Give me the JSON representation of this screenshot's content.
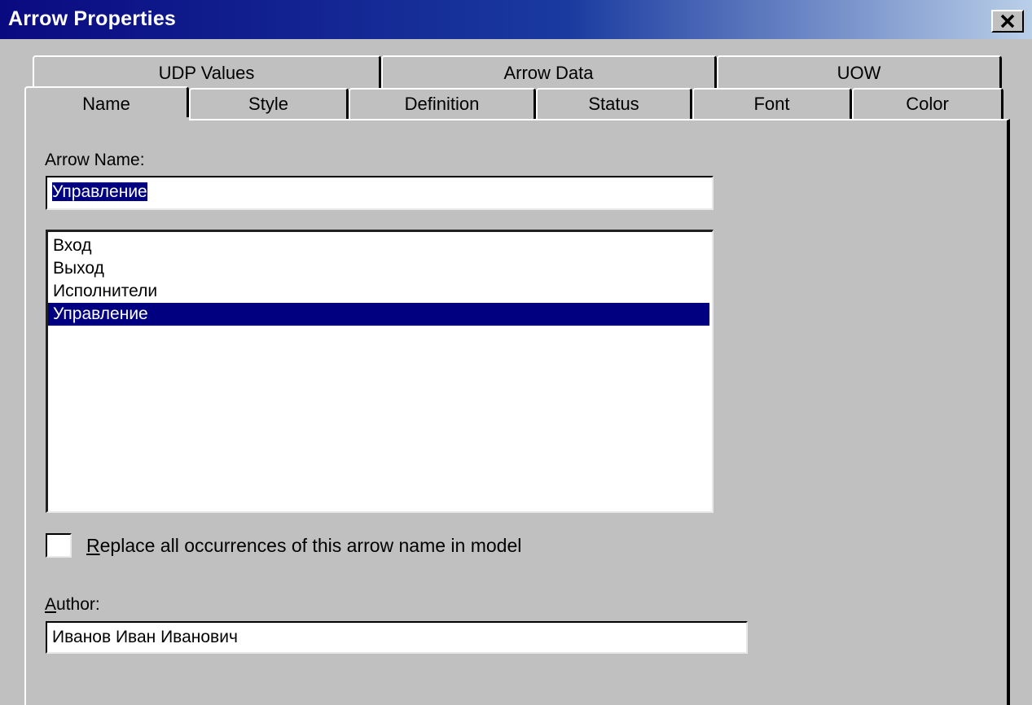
{
  "window": {
    "title": "Arrow Properties",
    "close_icon": "close-icon"
  },
  "tabs": {
    "row1": [
      {
        "label": "UDP Values"
      },
      {
        "label": "Arrow Data"
      },
      {
        "label": "UOW"
      }
    ],
    "row2": [
      {
        "label": "Name",
        "active": true
      },
      {
        "label": "Style"
      },
      {
        "label": "Definition"
      },
      {
        "label": "Status"
      },
      {
        "label": "Font"
      },
      {
        "label": "Color"
      }
    ]
  },
  "name_tab": {
    "arrow_name_label": "Arrow Name:",
    "arrow_name_value": "Управление",
    "arrow_list": [
      {
        "label": "Вход",
        "selected": false
      },
      {
        "label": "Выход",
        "selected": false
      },
      {
        "label": "Исполнители",
        "selected": false
      },
      {
        "label": "Управление",
        "selected": true
      }
    ],
    "replace_checkbox": {
      "checked": false,
      "accel": "R",
      "label_rest": "eplace all occurrences of this arrow name in model"
    },
    "author_label": {
      "accel": "A",
      "rest": "uthor:"
    },
    "author_value": "Иванов Иван Иванович"
  },
  "colors": {
    "title_bar": "#0a0a80",
    "selection": "#000080",
    "face": "#c0c0c0"
  }
}
